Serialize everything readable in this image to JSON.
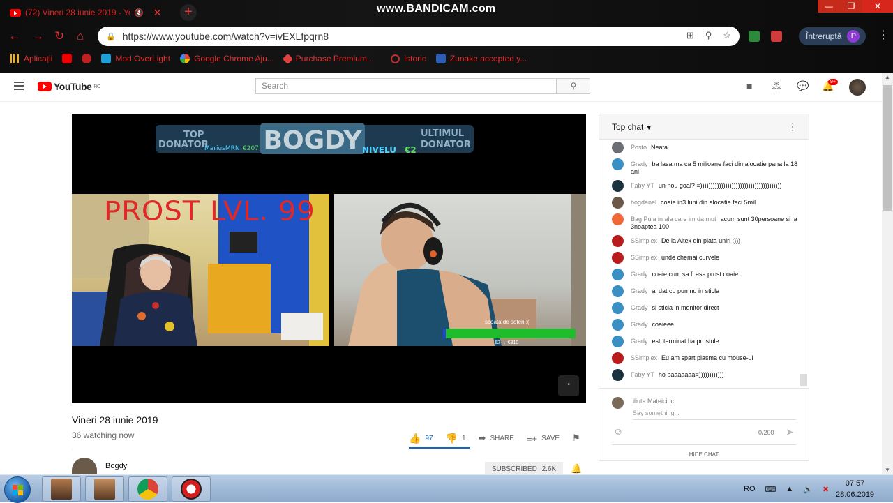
{
  "browser": {
    "tab_title": "(72) Vineri 28 iunie 2019 - Yo",
    "recorder_watermark": "www.BANDICAM.com",
    "url": "https://www.youtube.com/watch?v=ivEXLfpqrn8",
    "profile_status": "Întreruptă",
    "profile_initial": "P",
    "bookmarks": [
      {
        "label": "Aplicații"
      },
      {
        "label": ""
      },
      {
        "label": ""
      },
      {
        "label": "Mod OverLight"
      },
      {
        "label": "Google Chrome Aju..."
      },
      {
        "label": "Purchase Premium..."
      },
      {
        "label": "Istoric"
      },
      {
        "label": "Zunake accepted y..."
      }
    ]
  },
  "youtube": {
    "logo_text": "YouTube",
    "country_code": "RO",
    "search_placeholder": "Search",
    "notification_count": "9+"
  },
  "video": {
    "overlay_title": "PROST LVL. 99",
    "goal_label": "scoata de soferi :(",
    "goal_values": "€2 → €310",
    "title": "Vineri 28 iunie 2019",
    "watching": "36 watching now",
    "likes": "97",
    "dislikes": "1",
    "share_label": "SHARE",
    "save_label": "SAVE",
    "channel_name": "Bogdy",
    "subscribe_label": "SUBSCRIBED",
    "subscriber_count": "2.6K"
  },
  "chat": {
    "header": "Top chat",
    "messages": [
      {
        "name": "Posto",
        "text": "Neata",
        "color": "#6b6f75"
      },
      {
        "name": "Grady",
        "text": "ba lasa ma ca 5 milioane faci din alocatie pana la 18 ani",
        "color": "#3a8fc4"
      },
      {
        "name": "Faby YT",
        "text": "un nou goal? =)))))))))))))))))))))))))))))))))))))))",
        "color": "#1b3340"
      },
      {
        "name": "bogdanel",
        "text": "coaie in3 luni din alocatie faci 5mil",
        "color": "#6c5848"
      },
      {
        "name": "Bag Pula in ala care im da mut",
        "text": "acum sunt 30persoane si la 3noaptea 100",
        "color": "#f0673a"
      },
      {
        "name": "SSimplex",
        "text": "De la Altex din piata uniri :)))",
        "color": "#b81c1c"
      },
      {
        "name": "SSimplex",
        "text": "unde chemai curvele",
        "color": "#b81c1c"
      },
      {
        "name": "Grady",
        "text": "coaie cum sa fi asa prost coaie",
        "color": "#3a8fc4"
      },
      {
        "name": "Grady",
        "text": "ai dat cu pumnu in sticla",
        "color": "#3a8fc4"
      },
      {
        "name": "Grady",
        "text": "si sticla in monitor direct",
        "color": "#3a8fc4"
      },
      {
        "name": "Grady",
        "text": "coaieee",
        "color": "#3a8fc4"
      },
      {
        "name": "Grady",
        "text": "esti terminat ba prostule",
        "color": "#3a8fc4"
      },
      {
        "name": "SSimplex",
        "text": "Eu am spart plasma cu mouse-ul",
        "color": "#b81c1c"
      },
      {
        "name": "Faby YT",
        "text": "ho baaaaaaa=))))))))))))",
        "color": "#1b3340"
      }
    ],
    "compose_user": "iliuta Mateiciuc",
    "compose_placeholder": "Say something...",
    "char_count": "0/200",
    "hide_label": "HIDE CHAT"
  },
  "taskbar": {
    "language": "RO",
    "time": "07:57",
    "date": "28.06.2019"
  }
}
